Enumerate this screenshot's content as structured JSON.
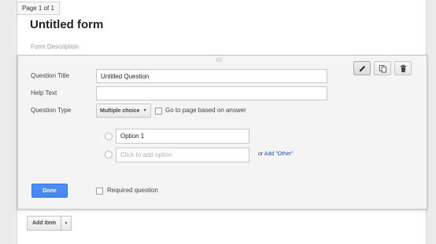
{
  "page_indicator": "Page 1 of 1",
  "form": {
    "title": "Untitled form",
    "description_placeholder": "Form Description"
  },
  "question": {
    "drag_handle_icon": "drag-dots-icon",
    "actions": [
      {
        "name": "edit",
        "icon": "pencil-icon"
      },
      {
        "name": "duplicate",
        "icon": "copy-icon"
      },
      {
        "name": "delete",
        "icon": "trash-icon"
      }
    ],
    "title_label": "Question Title",
    "title_value": "Untitled Question",
    "help_label": "Help Text",
    "help_value": "",
    "type_label": "Question Type",
    "type_value": "Multiple choice",
    "go_to_page_label": "Go to page based on answer",
    "options": [
      {
        "value": "Option 1"
      }
    ],
    "add_option_placeholder": "Click to add option",
    "or_text": "or",
    "add_other_link": "Add \"Other\"",
    "done_label": "Done",
    "required_label": "Required question"
  },
  "toolbar": {
    "add_item_label": "Add item"
  },
  "colors": {
    "accent": "#4d90fe",
    "link": "#1155cc"
  }
}
